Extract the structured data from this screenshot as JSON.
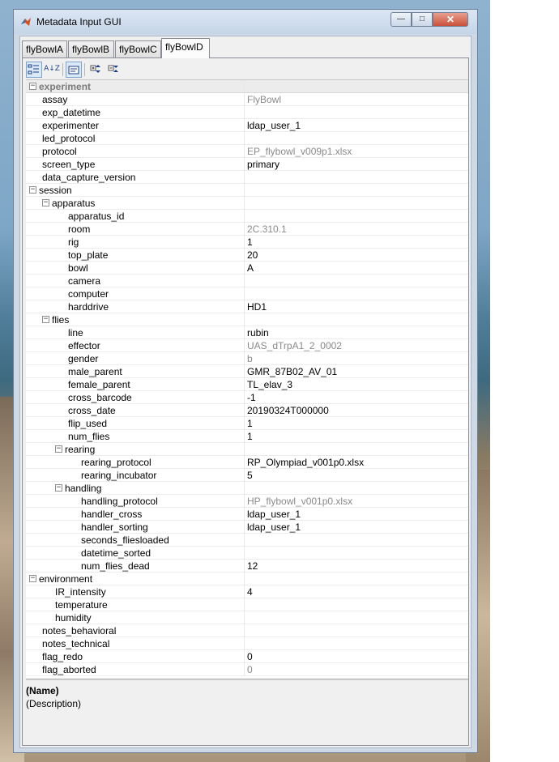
{
  "window": {
    "title": "Metadata Input GUI",
    "minimize_glyph": "—",
    "maximize_glyph": "□",
    "close_glyph": "✕"
  },
  "tabs": [
    {
      "label": "flyBowlA",
      "active": false
    },
    {
      "label": "flyBowlB",
      "active": false
    },
    {
      "label": "flyBowlC",
      "active": false
    },
    {
      "label": "flyBowlD",
      "active": true
    }
  ],
  "toolbar": {
    "categorized_icon": "categorized-view-icon",
    "sort_icon": "sort-az-icon",
    "sort_glyph": "A↓Z",
    "description_icon": "show-description-icon",
    "expand_icon": "expand-all-icon",
    "collapse_icon": "collapse-all-icon"
  },
  "properties": [
    {
      "name": "experiment",
      "value": "",
      "level": 0,
      "toggle": "⊟",
      "style": "header"
    },
    {
      "name": "assay",
      "value": "FlyBowl",
      "level": 1,
      "readonly": true
    },
    {
      "name": "exp_datetime",
      "value": "",
      "level": 1
    },
    {
      "name": "experimenter",
      "value": "ldap_user_1",
      "level": 1
    },
    {
      "name": "led_protocol",
      "value": "",
      "level": 1
    },
    {
      "name": "protocol",
      "value": "EP_flybowl_v009p1.xlsx",
      "level": 1,
      "readonly": true
    },
    {
      "name": "screen_type",
      "value": "primary",
      "level": 1
    },
    {
      "name": "data_capture_version",
      "value": "",
      "level": 1
    },
    {
      "name": "session",
      "value": "",
      "level": 0,
      "toggle": "⊟"
    },
    {
      "name": "apparatus",
      "value": "",
      "level": 1,
      "toggle": "⊟"
    },
    {
      "name": "apparatus_id",
      "value": "",
      "level": 3
    },
    {
      "name": "room",
      "value": "2C.310.1",
      "level": 3,
      "readonly": true
    },
    {
      "name": "rig",
      "value": "1",
      "level": 3
    },
    {
      "name": "top_plate",
      "value": "20",
      "level": 3
    },
    {
      "name": "bowl",
      "value": "A",
      "level": 3
    },
    {
      "name": "camera",
      "value": "",
      "level": 3
    },
    {
      "name": "computer",
      "value": "",
      "level": 3
    },
    {
      "name": "harddrive",
      "value": "HD1",
      "level": 3
    },
    {
      "name": "flies",
      "value": "",
      "level": 1,
      "toggle": "⊟"
    },
    {
      "name": "line",
      "value": "rubin",
      "level": 3
    },
    {
      "name": "effector",
      "value": "UAS_dTrpA1_2_0002",
      "level": 3,
      "readonly": true
    },
    {
      "name": "gender",
      "value": "b",
      "level": 3,
      "readonly": true
    },
    {
      "name": "male_parent",
      "value": "GMR_87B02_AV_01",
      "level": 3
    },
    {
      "name": "female_parent",
      "value": "TL_elav_3",
      "level": 3
    },
    {
      "name": "cross_barcode",
      "value": "-1",
      "level": 3
    },
    {
      "name": "cross_date",
      "value": "20190324T000000",
      "level": 3
    },
    {
      "name": "flip_used",
      "value": "1",
      "level": 3
    },
    {
      "name": "num_flies",
      "value": "1",
      "level": 3
    },
    {
      "name": "rearing",
      "value": "",
      "level": 2,
      "toggle": "⊟"
    },
    {
      "name": "rearing_protocol",
      "value": "RP_Olympiad_v001p0.xlsx",
      "level": 4
    },
    {
      "name": "rearing_incubator",
      "value": "5",
      "level": 4
    },
    {
      "name": "handling",
      "value": "",
      "level": 2,
      "toggle": "⊟"
    },
    {
      "name": "handling_protocol",
      "value": "HP_flybowl_v001p0.xlsx",
      "level": 4,
      "readonly": true
    },
    {
      "name": "handler_cross",
      "value": "ldap_user_1",
      "level": 4
    },
    {
      "name": "handler_sorting",
      "value": "ldap_user_1",
      "level": 4
    },
    {
      "name": "seconds_fliesloaded",
      "value": "",
      "level": 4
    },
    {
      "name": "datetime_sorted",
      "value": "",
      "level": 4
    },
    {
      "name": "num_flies_dead",
      "value": "12",
      "level": 4
    },
    {
      "name": "environment",
      "value": "",
      "level": 0,
      "toggle": "⊟"
    },
    {
      "name": "IR_intensity",
      "value": "4",
      "level": 2
    },
    {
      "name": "temperature",
      "value": "",
      "level": 2
    },
    {
      "name": "humidity",
      "value": "",
      "level": 2
    },
    {
      "name": "notes_behavioral",
      "value": "",
      "level": 1
    },
    {
      "name": "notes_technical",
      "value": "",
      "level": 1
    },
    {
      "name": "flag_redo",
      "value": "0",
      "level": 1
    },
    {
      "name": "flag_aborted",
      "value": "0",
      "level": 1,
      "readonly": true
    }
  ],
  "description": {
    "name": "(Name)",
    "text": "(Description)"
  },
  "colors": {
    "readonly_text": "#8a8a8a",
    "header_bg": "#ececec",
    "titlebar": "#c5d5e8",
    "close_button": "#c9513c"
  }
}
